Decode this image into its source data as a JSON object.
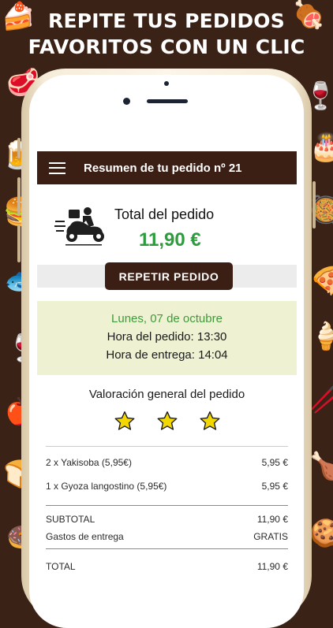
{
  "headline": {
    "line1": "REPITE TUS PEDIDOS",
    "line2": "FAVORITOS CON UN CLIC"
  },
  "app": {
    "title": "Resumen de tu pedido nº 21"
  },
  "summary": {
    "total_label": "Total del pedido",
    "total_value": "11,90 €",
    "repeat_button": "REPETIR PEDIDO"
  },
  "schedule": {
    "date": "Lunes, 07 de octubre",
    "order_time": "Hora del pedido: 13:30",
    "delivery_time": "Hora de entrega: 14:04"
  },
  "rating": {
    "title": "Valoración general del pedido",
    "stars": 3
  },
  "items": [
    {
      "name": "2 x Yakisoba (5,95€)",
      "price": "5,95 €"
    },
    {
      "name": "1 x Gyoza langostino (5,95€)",
      "price": "5,95 €"
    }
  ],
  "totals": {
    "subtotal_label": "SUBTOTAL",
    "subtotal_value": "11,90 €",
    "delivery_label": "Gastos de entrega",
    "delivery_value": "GRATIS",
    "total_label": "TOTAL",
    "total_value": "11,90 €"
  },
  "colors": {
    "brand_brown": "#3c1f14",
    "accent_green": "#2d9c3c",
    "date_bg": "#eef2d3",
    "star_yellow": "#f2d700"
  },
  "icons": [
    "menu-icon",
    "delivery-scooter-icon",
    "star-icon"
  ]
}
